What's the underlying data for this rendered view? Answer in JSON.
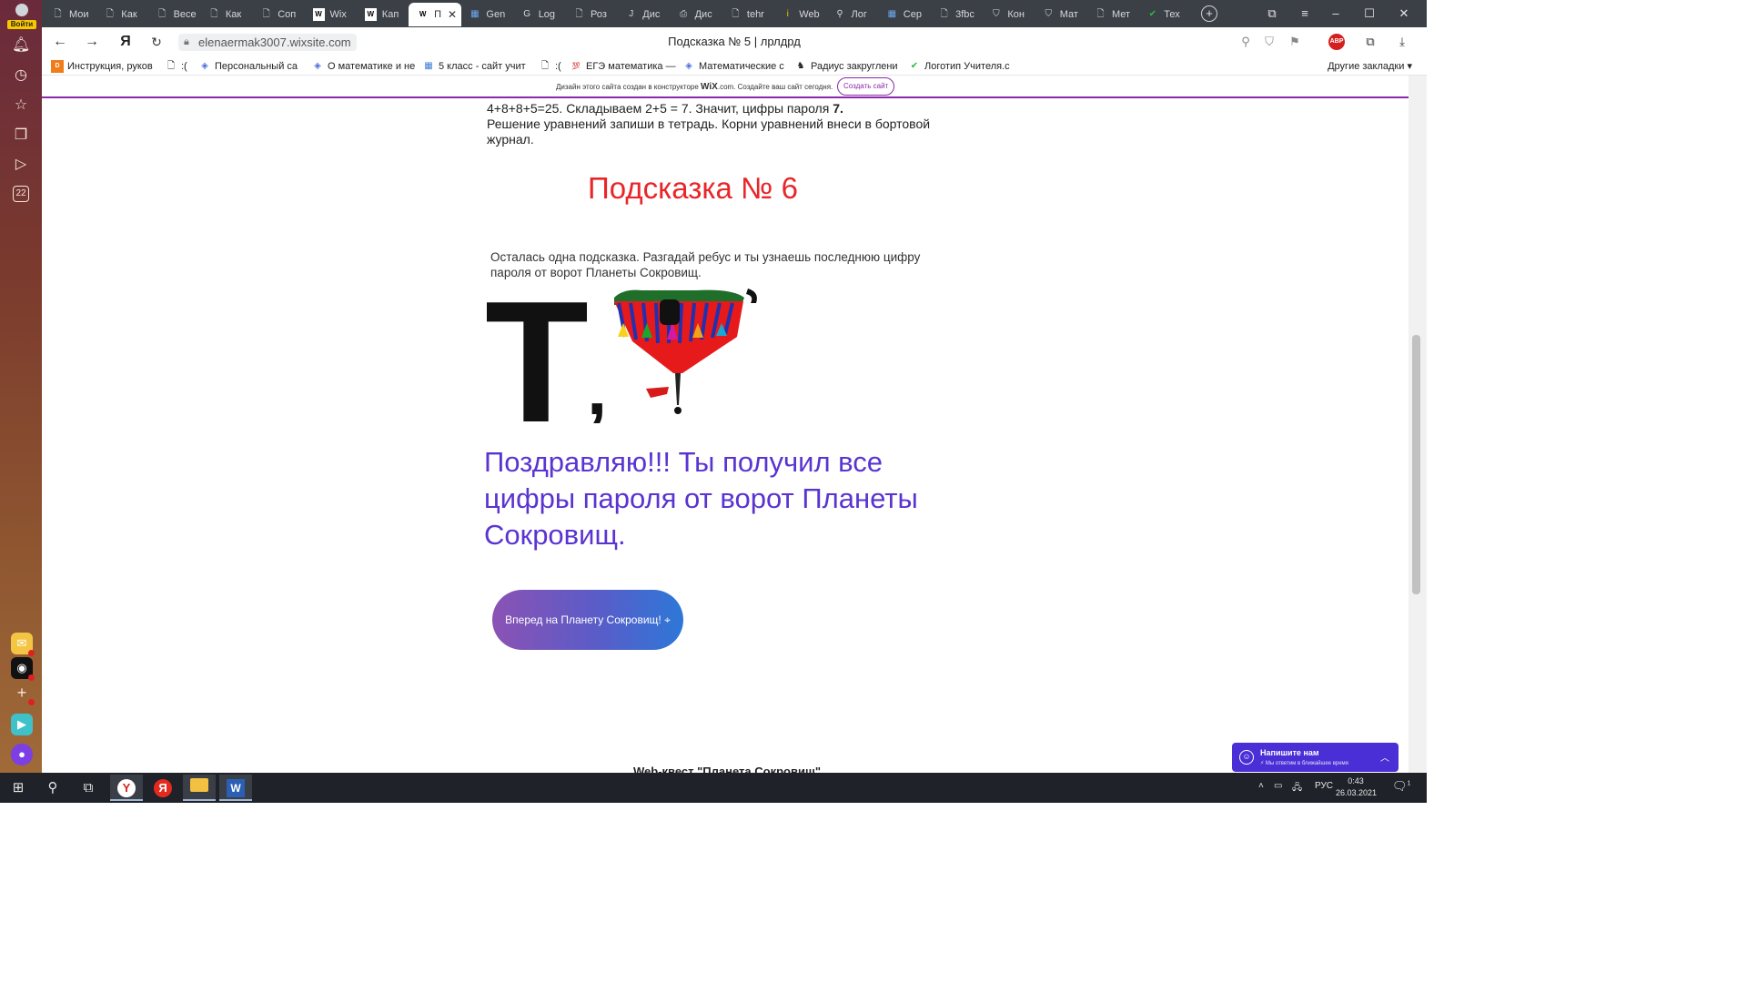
{
  "sidebar": {
    "login_label": "Войти",
    "badge_count": "22"
  },
  "tabs": [
    {
      "label": "Мои",
      "icon": "doc-icon"
    },
    {
      "label": "Как",
      "icon": "doc-icon"
    },
    {
      "label": "Весе",
      "icon": "doc-icon"
    },
    {
      "label": "Как",
      "icon": "doc-icon"
    },
    {
      "label": "Соп",
      "icon": "doc-icon"
    },
    {
      "label": "Wix",
      "icon": "wix-icon"
    },
    {
      "label": "Кап",
      "icon": "wix-icon"
    },
    {
      "label": "П",
      "icon": "wix-icon"
    },
    {
      "label": "Gen",
      "icon": "forms-icon"
    },
    {
      "label": "Log",
      "icon": "g-icon"
    },
    {
      "label": "Роз",
      "icon": "doc-icon"
    },
    {
      "label": "Дис",
      "icon": "j-icon"
    },
    {
      "label": "Дис",
      "icon": "pdf-icon"
    },
    {
      "label": "tehr",
      "icon": "doc-icon"
    },
    {
      "label": "Web",
      "icon": "info-icon"
    },
    {
      "label": "Лог",
      "icon": "search-icon"
    },
    {
      "label": "Сер",
      "icon": "forms-icon"
    },
    {
      "label": "3fbc",
      "icon": "doc-icon"
    },
    {
      "label": "Кон",
      "icon": "shield-icon"
    },
    {
      "label": "Мат",
      "icon": "shield-icon"
    },
    {
      "label": "Мет",
      "icon": "doc-icon"
    },
    {
      "label": "Тех",
      "icon": "check-icon"
    }
  ],
  "tab_new_label": "+",
  "address": {
    "url": "elenaermak3007.wixsite.com",
    "title": "Подсказка № 5 | лрлдрд",
    "abp_label": "ABP"
  },
  "bookmarks": [
    {
      "label": "Инструкция, руков",
      "icon": "dns-icon"
    },
    {
      "label": ":(",
      "icon": "doc-icon"
    },
    {
      "label": "Персональный са",
      "icon": "diamond-icon"
    },
    {
      "label": "О математике и не",
      "icon": "diamond-icon"
    },
    {
      "label": "5 класс - сайт учит",
      "icon": "forms-icon"
    },
    {
      "label": ":(",
      "icon": "doc-icon"
    },
    {
      "label": "ЕГЭ математика —",
      "icon": "100-icon"
    },
    {
      "label": "Математические с",
      "icon": "diamond-icon"
    },
    {
      "label": "Радиус закруглени",
      "icon": "owl-icon"
    },
    {
      "label": "Логотип Учителя.с",
      "icon": "check-icon"
    }
  ],
  "other_bookmarks": "Другие закладки",
  "wix_banner": {
    "prefix": "Дизайн этого сайта создан в конструкторе",
    "brand": "WiX",
    "suffix": ".com. Создайте ваш сайт сегодня.",
    "button": "Создать сайт"
  },
  "page": {
    "intro_line1_a": "4+8+8+5=25.  Складываем 2+5 = 7. Значит, цифры пароля ",
    "intro_line1_b": "7.",
    "intro_line2": "Решение уравнений запиши в тетрадь. Корни уравнений внеси в бортовой журнал.",
    "hint_title": "Подсказка № 6",
    "hint_text": "Осталась одна подсказка. Разгадай ребус и ты узнаешь последнюю цифру пароля от ворот Планеты Сокровищ.",
    "rebus_letter": "Т",
    "rebus_comma": ",",
    "congrats": "Поздравляю!!! Ты получил все цифры пароля от ворот Планеты Сокровищ.",
    "go_button": "Вперед на Планету Сокровищ! ⌖",
    "footer": "Web-квест \"Планета Сокровищ\""
  },
  "chat": {
    "title": "Напишите нам",
    "subtitle": "⚡ Мы ответим в ближайшее время"
  },
  "taskbar": {
    "lang": "РУС",
    "time": "0:43",
    "date": "26.03.2021",
    "notif_count": "1"
  },
  "colors": {
    "hint_title": "#e8262a",
    "congrats": "#5a34d0",
    "wix_accent": "#8a2aa8",
    "chat_bg": "#4a2fd6"
  }
}
